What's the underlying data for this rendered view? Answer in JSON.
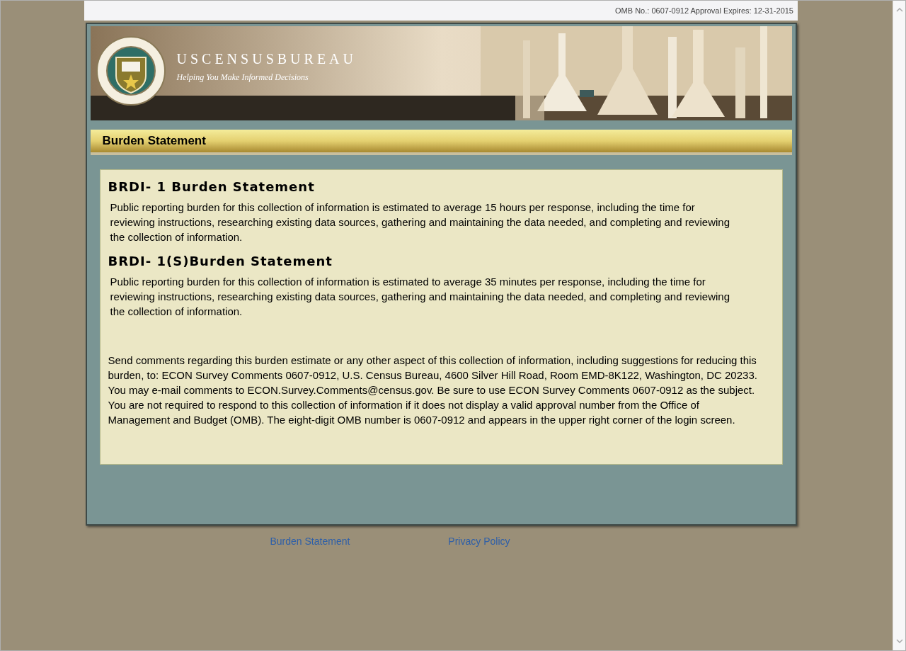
{
  "omb_notice": "OMB No.: 0607-0912 Approval Expires: 12-31-2015",
  "banner": {
    "title": "USCENSUSBUREAU",
    "tagline": "Helping You Make Informed Decisions"
  },
  "section_header": "Burden Statement",
  "statements": [
    {
      "heading": "BRDI- 1 Burden Statement",
      "text": "Public reporting burden for this collection of information is estimated to average 15 hours per response, including the time for reviewing instructions, researching existing data sources, gathering and maintaining the data needed, and completing and reviewing the collection of information."
    },
    {
      "heading": "BRDI- 1(S)Burden Statement",
      "text": "Public reporting burden for this collection of information is estimated to average 35 minutes per response, including the time for reviewing instructions, researching existing data sources, gathering and maintaining the data needed, and completing and reviewing the collection of information."
    }
  ],
  "comments_text": "Send comments regarding this burden estimate or any other aspect of this collection of information, including suggestions for reducing this burden, to: ECON Survey Comments 0607-0912, U.S. Census Bureau, 4600 Silver Hill Road, Room EMD-8K122, Washington, DC 20233. You may e-mail comments to ECON.Survey.Comments@census.gov.   Be sure to use ECON Survey Comments 0607-0912 as the subject. You are not required to respond to this collection of information if it does not display a valid approval number from the Office of Management and Budget (OMB). The eight-digit OMB number is 0607-0912 and appears in the upper right corner of the login screen.",
  "footer_links": [
    "Burden Statement",
    "Privacy Policy"
  ]
}
